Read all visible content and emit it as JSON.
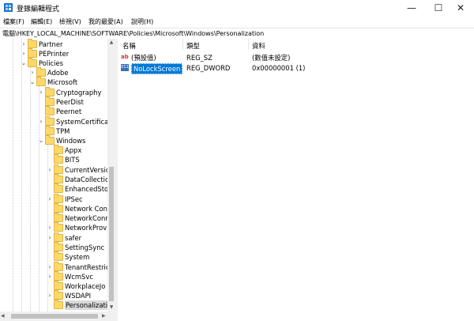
{
  "window": {
    "title": "登錄編輯程式",
    "controls": {
      "minimize": "—",
      "maximize": "☐",
      "close": "✕"
    }
  },
  "menu": [
    "檔案(F)",
    "編輯(E)",
    "檢視(V)",
    "我的最愛(A)",
    "說明(H)"
  ],
  "address": "電腦\\HKEY_LOCAL_MACHINE\\SOFTWARE\\Policies\\Microsoft\\Windows\\Personalization",
  "tree": [
    {
      "label": "Partner",
      "chevron": "›"
    },
    {
      "label": "PEPrinter",
      "chevron": "›"
    },
    {
      "label": "Policies",
      "chevron": "⌄"
    },
    {
      "label": "Adobe",
      "chevron": "›"
    },
    {
      "label": "Microsoft",
      "chevron": "⌄"
    },
    {
      "label": "Cryptography",
      "chevron": "›"
    },
    {
      "label": "PeerDist",
      "chevron": ""
    },
    {
      "label": "Peernet",
      "chevron": ""
    },
    {
      "label": "SystemCertificat",
      "chevron": "›"
    },
    {
      "label": "TPM",
      "chevron": ""
    },
    {
      "label": "Windows",
      "chevron": "⌄"
    },
    {
      "label": "Appx",
      "chevron": ""
    },
    {
      "label": "BITS",
      "chevron": ""
    },
    {
      "label": "CurrentVersio",
      "chevron": "›"
    },
    {
      "label": "DataCollectic",
      "chevron": ""
    },
    {
      "label": "EnhancedSto",
      "chevron": ""
    },
    {
      "label": "IPSec",
      "chevron": "›"
    },
    {
      "label": "Network Con",
      "chevron": ""
    },
    {
      "label": "NetworkConn",
      "chevron": ""
    },
    {
      "label": "NetworkProvi",
      "chevron": "›"
    },
    {
      "label": "safer",
      "chevron": "›"
    },
    {
      "label": "SettingSync",
      "chevron": ""
    },
    {
      "label": "System",
      "chevron": ""
    },
    {
      "label": "TenantRestric",
      "chevron": "›"
    },
    {
      "label": "WcmSvc",
      "chevron": "›"
    },
    {
      "label": "WorkplaceJo",
      "chevron": ""
    },
    {
      "label": "WSDAPI",
      "chevron": "›"
    },
    {
      "label": "Personalizatic",
      "chevron": ""
    }
  ],
  "columns": {
    "name": "名稱",
    "type": "類型",
    "data": "資料"
  },
  "values": [
    {
      "icon": "string-value-icon",
      "icon_text": "ab",
      "name": "(預設值)",
      "type": "REG_SZ",
      "data": "(數值未設定)"
    },
    {
      "icon": "binary-value-icon",
      "icon_text": "011",
      "name": "NoLockScreen",
      "type": "REG_DWORD",
      "data": "0x00000001 (1)"
    }
  ]
}
